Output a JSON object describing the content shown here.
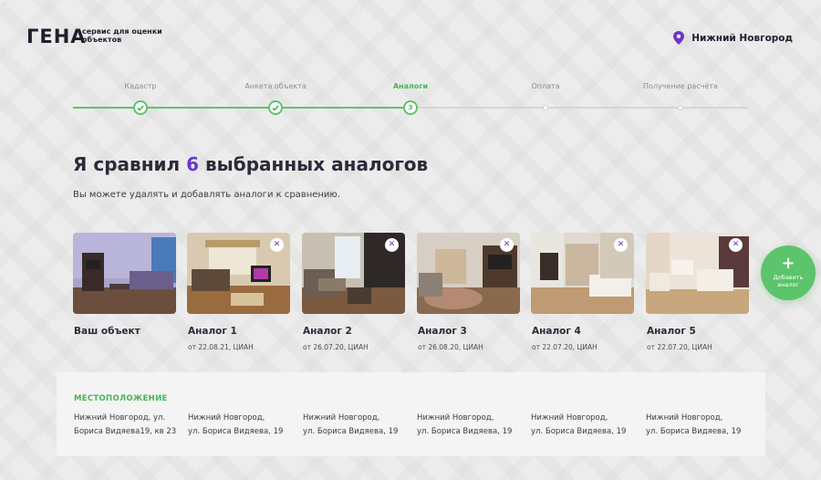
{
  "brand": {
    "logo": "ГЕНА",
    "tagline": "сервис для оценки объектов"
  },
  "header": {
    "city": "Нижний Новгород",
    "city_icon": "map-pin-icon"
  },
  "stepper": {
    "steps": [
      {
        "label": "Кадастр",
        "state": "done"
      },
      {
        "label": "Анкета объекта",
        "state": "done"
      },
      {
        "label": "Аналоги",
        "state": "active",
        "number": "3"
      },
      {
        "label": "Оплата",
        "state": "todo"
      },
      {
        "label": "Получение расчёта",
        "state": "todo"
      }
    ]
  },
  "headline": {
    "before": "Я сравнил ",
    "count": "6",
    "after": " выбранных аналогов"
  },
  "subline": "Вы можете удалять и добавлять аналоги к сравнению.",
  "cards": [
    {
      "title": "Ваш объект",
      "meta": "",
      "removable": false
    },
    {
      "title": "Аналог 1",
      "meta": "от 22.08.21, ЦИАН",
      "removable": true
    },
    {
      "title": "Аналог 2",
      "meta": "от 26.07.20, ЦИАН",
      "removable": true
    },
    {
      "title": "Аналог 3",
      "meta": "от 26.08.20, ЦИАН",
      "removable": true
    },
    {
      "title": "Аналог 4",
      "meta": "от 22.07.20, ЦИАН",
      "removable": true
    },
    {
      "title": "Аналог 5",
      "meta": "от 22.07.20, ЦИАН",
      "removable": true
    }
  ],
  "remove_glyph": "✕",
  "add_button": {
    "plus": "+",
    "label_line1": "Добавить",
    "label_line2": "аналог"
  },
  "location": {
    "title": "МЕСТОПОЛОЖЕНИЕ",
    "values": [
      {
        "line1": "Нижний Новгород, ул.",
        "line2": "Бориса Видяева19, кв 23"
      },
      {
        "line1": "Нижний Новгород,",
        "line2": "ул. Бориса Видяева, 19"
      },
      {
        "line1": "Нижний Новгород,",
        "line2": "ул. Бориса Видяева, 19"
      },
      {
        "line1": "Нижний Новгород,",
        "line2": "ул. Бориса Видяева, 19"
      },
      {
        "line1": "Нижний Новгород,",
        "line2": "ул. Бориса Видяева, 19"
      },
      {
        "line1": "Нижний Новгород,",
        "line2": "ул. Бориса Видяева, 19"
      }
    ]
  },
  "colors": {
    "accent_green": "#5cc46a",
    "accent_purple": "#6b35c9",
    "text_dark": "#2b2b3a"
  }
}
